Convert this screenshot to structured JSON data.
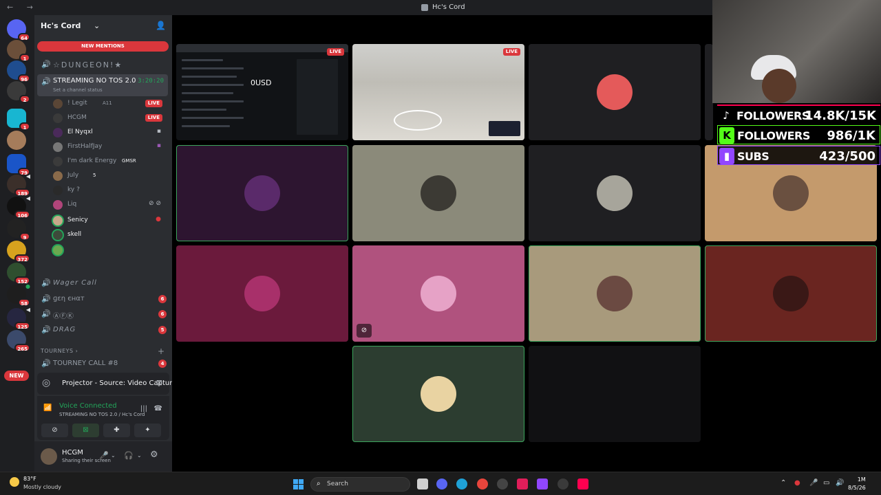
{
  "window": {
    "title": "Hc's Cord",
    "nav": "← →"
  },
  "server": {
    "name": "Hc's Cord",
    "new_mentions": "NEW MENTIONS"
  },
  "rail": {
    "badges": [
      "64",
      "1",
      "96",
      "2",
      "1",
      "79",
      "189",
      "106",
      "9",
      "372",
      "152",
      "58",
      "125",
      "265"
    ],
    "new_label": "NEW"
  },
  "channels": {
    "dungeon": "☆DUNGEON!★",
    "active": {
      "name": "STREAMING NO TOS 2.0",
      "time": "3:20:20",
      "status": "Set a channel status"
    },
    "wager": "Wager Call",
    "gen_chat": "ɡεη єнαт",
    "gen_chat_count": "6",
    "afk": "ⒶⒻⓀ",
    "afk_count": "6",
    "drag": "DRAG",
    "drag_count": "5",
    "category": "TOURNEYS",
    "tourney": "TOURNEY CALL #8",
    "tourney_count": "4"
  },
  "members": [
    {
      "name": "! Legit",
      "extra": "A11",
      "live": "LIVE"
    },
    {
      "name": "HCGM",
      "live": "LIVE"
    },
    {
      "name": "El Nyqxl"
    },
    {
      "name": "FirstHalfJay"
    },
    {
      "name": "I'm dark Energy",
      "extra": "GMSR"
    },
    {
      "name": "July",
      "extra": "5"
    },
    {
      "name": "ky ?"
    },
    {
      "name": "Liq"
    },
    {
      "name": "Senicy"
    },
    {
      "name": "skell"
    }
  ],
  "projector": {
    "label": "Projector - Source: Video Capture ..."
  },
  "voice": {
    "status": "Voice Connected",
    "channel": "STREAMING NO TOS 2.0 / Hc's Cord"
  },
  "user": {
    "name": "HCGM",
    "status": "Sharing their screen"
  },
  "tiles": {
    "live_label": "LIVE",
    "usd_label": "0USD"
  },
  "overlay": {
    "tiktok": {
      "label": "FOLLOWERS",
      "value": "14.8K/15K"
    },
    "kick": {
      "label": "FOLLOWERS",
      "value": "986/1K"
    },
    "twitch": {
      "label": "SUBS",
      "value": "423/500"
    }
  },
  "taskbar": {
    "weather_temp": "83°F",
    "weather_desc": "Mostly cloudy",
    "search_label": "Search",
    "clock_time": "1M",
    "clock_date": "8/5/26"
  },
  "colors": {
    "accent_green": "#23a55a",
    "alert_red": "#da373c",
    "sidebar_bg": "#2b2d31"
  }
}
